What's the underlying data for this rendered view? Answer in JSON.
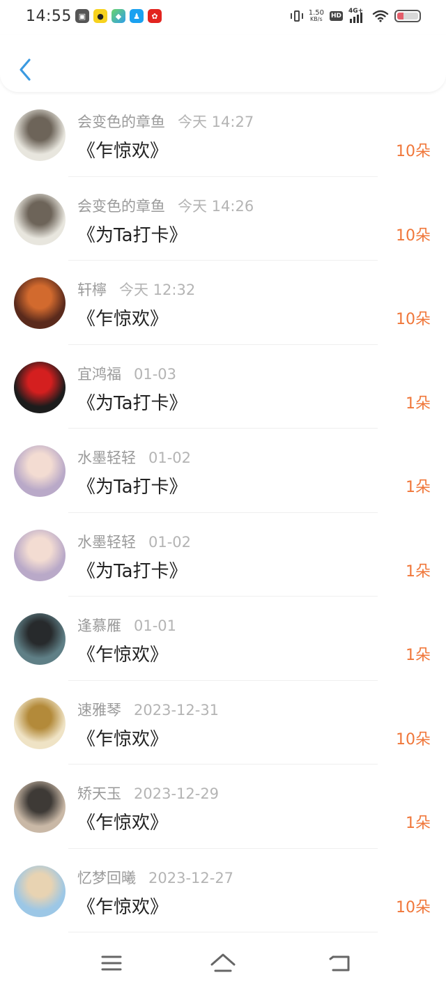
{
  "status_bar": {
    "time": "14:55",
    "net_speed_value": "1.50",
    "net_speed_unit": "KB/s",
    "hd_badge": "HD",
    "network_type": "4G+"
  },
  "header": {
    "back_icon": "chevron-left-icon"
  },
  "gift_records": [
    {
      "sender": "会变色的章鱼",
      "time": "今天 14:27",
      "gift": "《乍惊欢》",
      "count": "10朵",
      "avatar_colors": [
        "#e8e6de",
        "#6d6459"
      ]
    },
    {
      "sender": "会变色的章鱼",
      "time": "今天 14:26",
      "gift": "《为Ta打卡》",
      "count": "10朵",
      "avatar_colors": [
        "#e8e6de",
        "#6d6459"
      ]
    },
    {
      "sender": "轩檸",
      "time": "今天 12:32",
      "gift": "《乍惊欢》",
      "count": "10朵",
      "avatar_colors": [
        "#5a2a1c",
        "#d26a2e"
      ]
    },
    {
      "sender": "宜鸿福",
      "time": "01-03",
      "gift": "《为Ta打卡》",
      "count": "1朵",
      "avatar_colors": [
        "#1c1c1c",
        "#d41f1f"
      ]
    },
    {
      "sender": "水墨轻轻",
      "time": "01-02",
      "gift": "《为Ta打卡》",
      "count": "1朵",
      "avatar_colors": [
        "#b9a9c8",
        "#f3dcd2"
      ]
    },
    {
      "sender": "水墨轻轻",
      "time": "01-02",
      "gift": "《为Ta打卡》",
      "count": "1朵",
      "avatar_colors": [
        "#b9a9c8",
        "#f3dcd2"
      ]
    },
    {
      "sender": "逢慕雁",
      "time": "01-01",
      "gift": "《乍惊欢》",
      "count": "1朵",
      "avatar_colors": [
        "#5f7f86",
        "#272a2c"
      ]
    },
    {
      "sender": "速雅琴",
      "time": "2023-12-31",
      "gift": "《乍惊欢》",
      "count": "10朵",
      "avatar_colors": [
        "#efe3c5",
        "#b38a3a"
      ]
    },
    {
      "sender": "矫天玉",
      "time": "2023-12-29",
      "gift": "《乍惊欢》",
      "count": "1朵",
      "avatar_colors": [
        "#c9b8a6",
        "#3e3a36"
      ]
    },
    {
      "sender": "忆梦回曦",
      "time": "2023-12-27",
      "gift": "《乍惊欢》",
      "count": "10朵",
      "avatar_colors": [
        "#9cc7e6",
        "#e8d3b2"
      ]
    }
  ],
  "nav_bar": {
    "menu_icon": "menu-icon",
    "home_icon": "home-icon",
    "back_icon": "back-icon"
  },
  "colors": {
    "count_accent": "#f0773a",
    "back_accent": "#3b9ae1",
    "name_gray": "#9a9a9a",
    "title_dark": "#222222"
  }
}
